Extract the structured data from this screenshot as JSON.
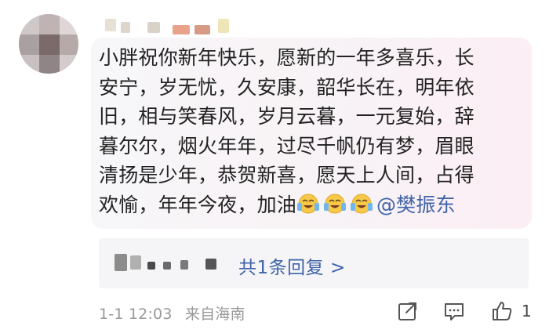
{
  "comment": {
    "lines": [
      "小胖祝你新年快乐，愿新的一年多喜乐，长",
      "安宁，岁无忧，久安康，韶华长在，明年依",
      "旧，相与笑春风，岁月云暮，一元复始，辞",
      "暮尔尔，烟火年年，过尽千帆仍有梦，眉眼",
      "清扬是少年，恭贺新喜，愿天上人间，占得"
    ],
    "last_line_text": "欢愉，年年今夜，加油",
    "emoji_count": 3,
    "emoji_icon": "crying-laughing-face",
    "mention": "@樊振东"
  },
  "replies": {
    "label": "共1条回复 >"
  },
  "footer": {
    "time": "1-1 12:03",
    "location": "来自海南",
    "like_count": "1",
    "icons": [
      "share-icon",
      "comment-icon",
      "like-icon"
    ]
  },
  "colors": {
    "link": "#3f63a8",
    "meta": "#999999",
    "bubble_start": "#f7f6f8",
    "bubble_end": "#fbeef4"
  }
}
